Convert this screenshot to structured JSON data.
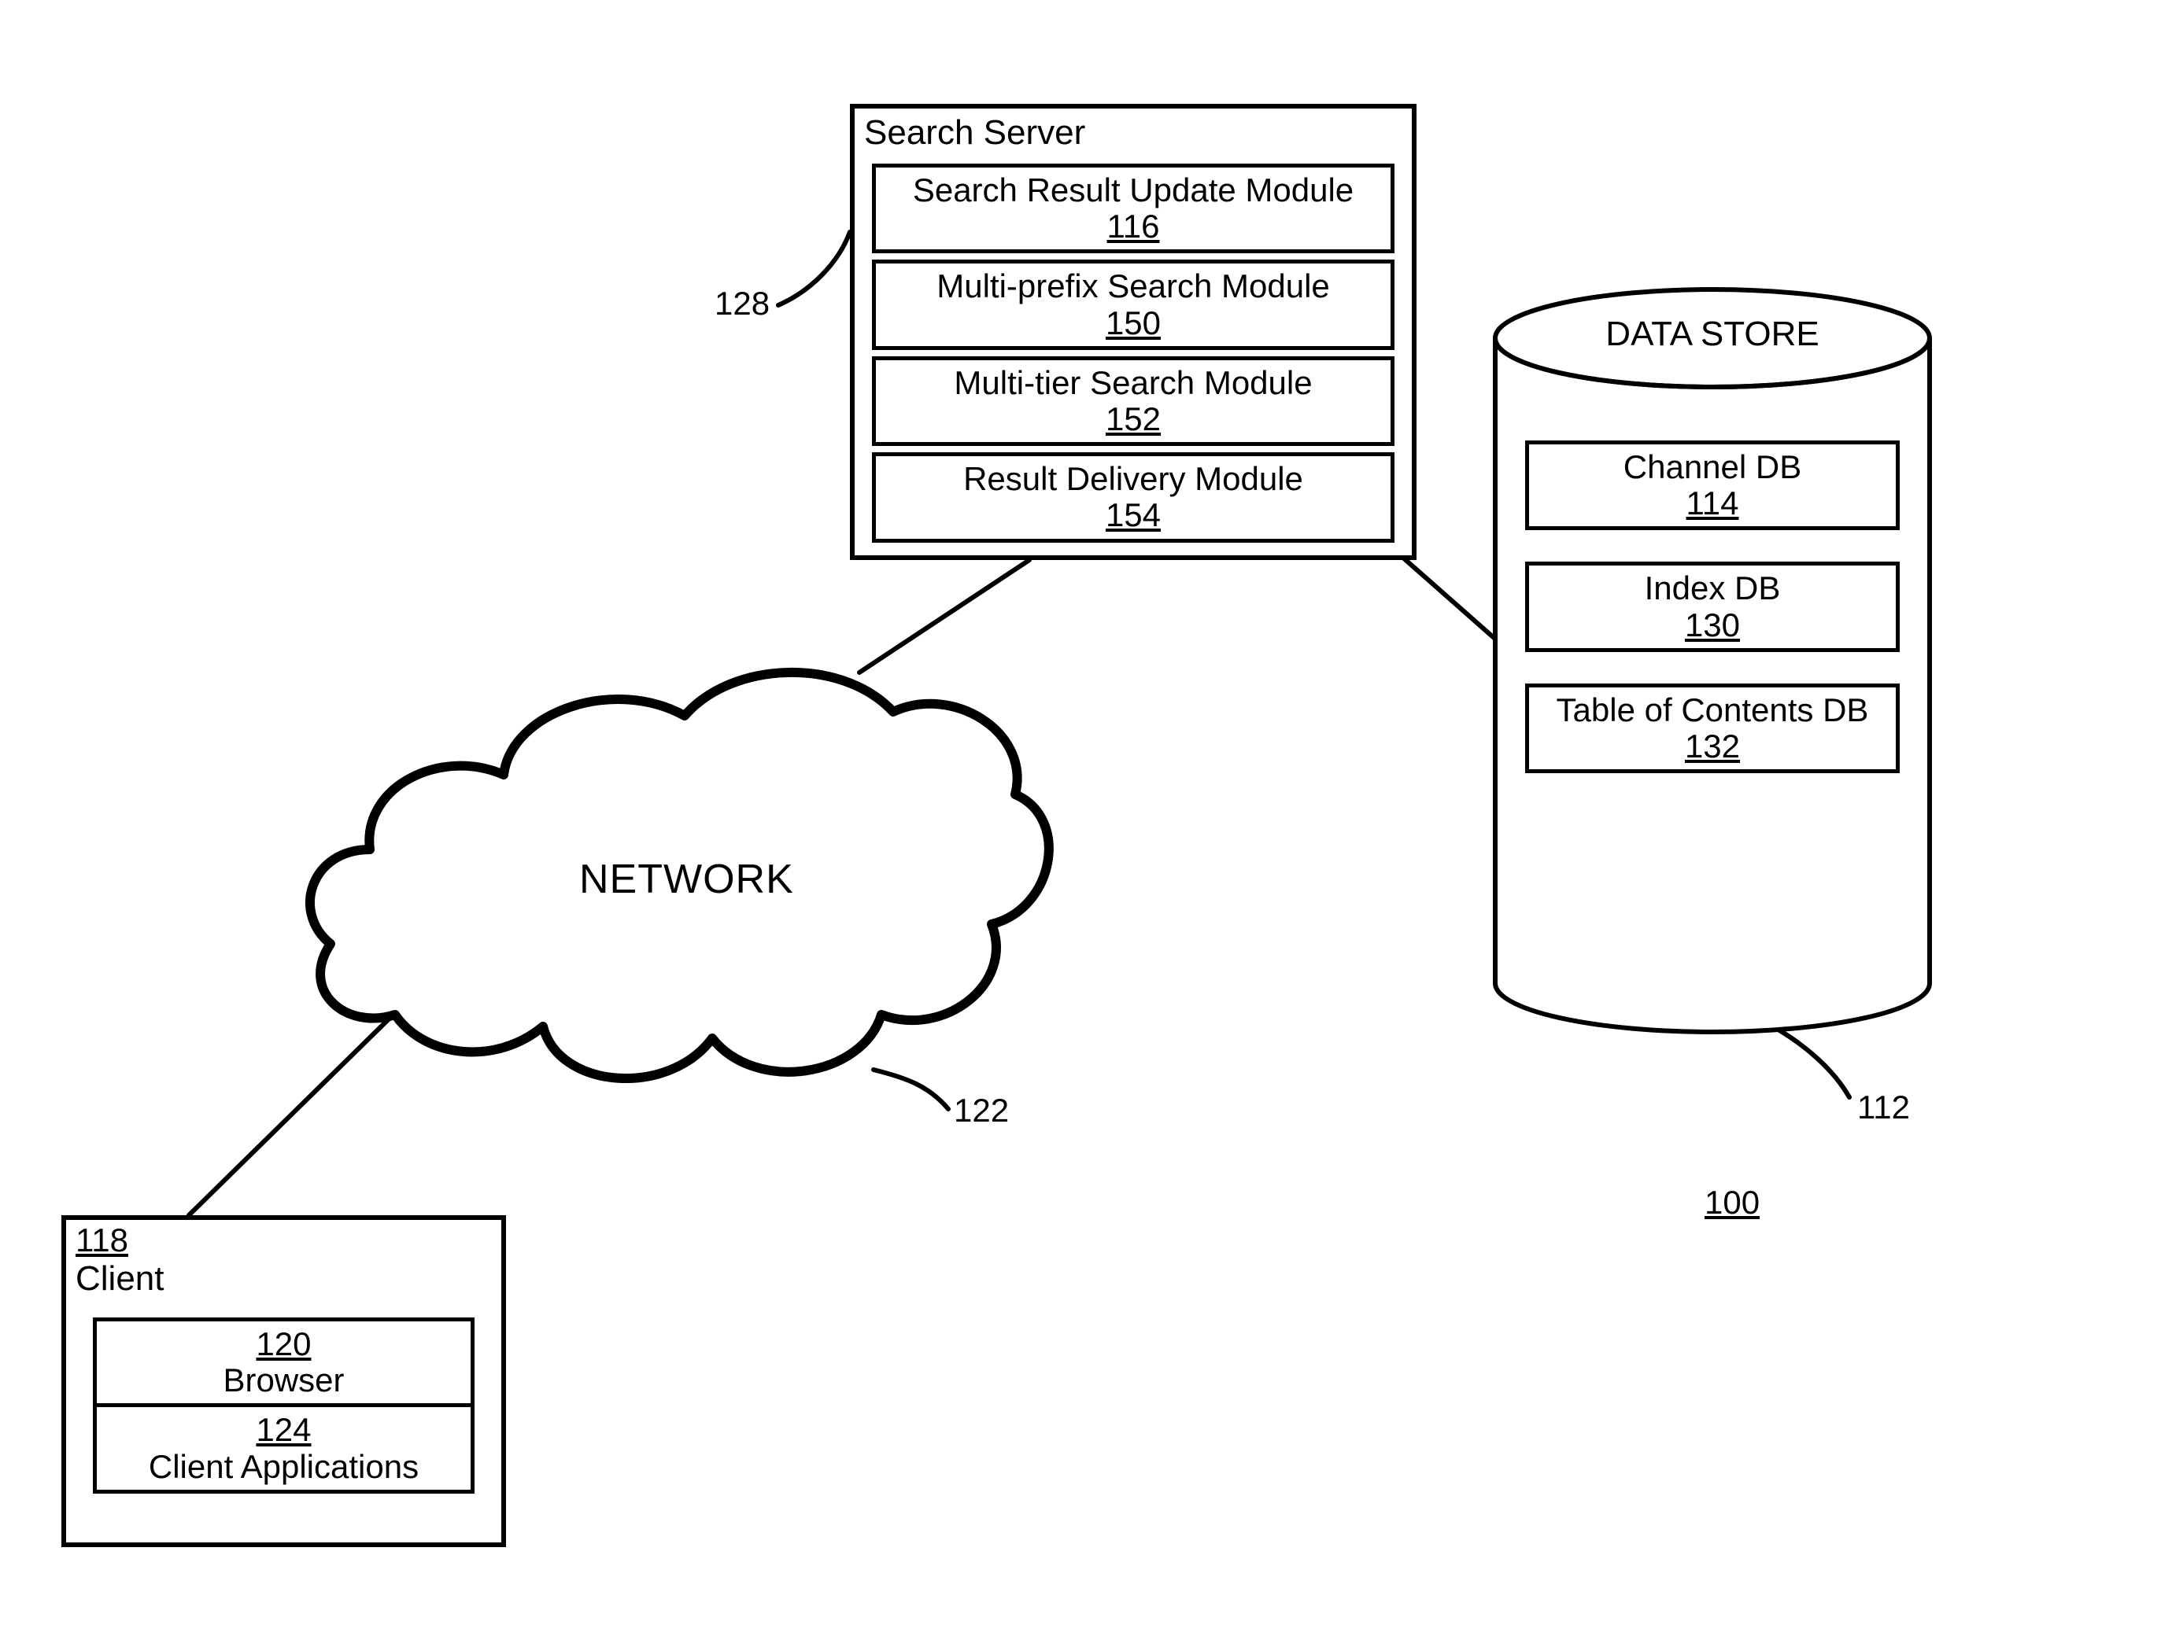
{
  "figure_ref": "100",
  "search_server": {
    "title": "Search Server",
    "ref_label": "128",
    "modules": [
      {
        "title": "Search Result Update Module",
        "ref": "116"
      },
      {
        "title": "Multi-prefix Search Module",
        "ref": "150"
      },
      {
        "title": "Multi-tier Search Module",
        "ref": "152"
      },
      {
        "title": "Result Delivery Module",
        "ref": "154"
      }
    ]
  },
  "data_store": {
    "title": "DATA STORE",
    "ref_label": "112",
    "items": [
      {
        "title": "Channel DB",
        "ref": "114"
      },
      {
        "title": "Index DB",
        "ref": "130"
      },
      {
        "title": "Table of Contents DB",
        "ref": "132"
      }
    ]
  },
  "network": {
    "label": "NETWORK",
    "ref_label": "122"
  },
  "client": {
    "ref": "118",
    "title": "Client",
    "items": [
      {
        "ref": "120",
        "title": "Browser"
      },
      {
        "ref": "124",
        "title": "Client Applications"
      }
    ]
  }
}
